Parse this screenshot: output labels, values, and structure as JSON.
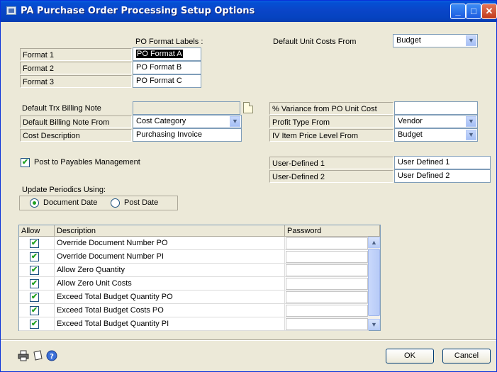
{
  "window": {
    "title": "PA Purchase Order Processing Setup Options",
    "minimize": "_",
    "maximize": "□",
    "close": "✕"
  },
  "formats": {
    "header": "PO Format Labels :",
    "rows": [
      {
        "label": "Format 1",
        "value": "PO Format A"
      },
      {
        "label": "Format 2",
        "value": "PO Format B"
      },
      {
        "label": "Format 3",
        "value": "PO Format C"
      }
    ]
  },
  "unit_costs": {
    "label": "Default Unit Costs From",
    "value": "Budget"
  },
  "billing": {
    "trx_note_label": "Default Trx Billing Note",
    "trx_note_value": "",
    "note_from_label": "Default Billing Note From",
    "note_from_value": "Cost Category",
    "cost_desc_label": "Cost Description",
    "cost_desc_value": "Purchasing Invoice"
  },
  "right_fields": {
    "variance_label": "% Variance from PO Unit Cost",
    "variance_value": "",
    "profit_type_label": "Profit Type From",
    "profit_type_value": "Vendor",
    "price_level_label": "IV Item Price Level From",
    "price_level_value": "Budget"
  },
  "post_payables": {
    "label": "Post to Payables Management",
    "checked": true
  },
  "user_defined": [
    {
      "label": "User-Defined 1",
      "value": "User Defined 1"
    },
    {
      "label": "User-Defined 2",
      "value": "User Defined 2"
    }
  ],
  "periodics": {
    "label": "Update Periodics Using:",
    "document_date": "Document Date",
    "post_date": "Post Date",
    "selected": "Document Date"
  },
  "grid": {
    "headers": {
      "allow": "Allow",
      "description": "Description",
      "password": "Password"
    },
    "rows": [
      {
        "allow": true,
        "description": "Override Document Number PO",
        "password": ""
      },
      {
        "allow": true,
        "description": "Override Document Number PI",
        "password": ""
      },
      {
        "allow": true,
        "description": "Allow Zero Quantity",
        "password": ""
      },
      {
        "allow": true,
        "description": "Allow Zero Unit Costs",
        "password": ""
      },
      {
        "allow": true,
        "description": "Exceed Total Budget Quantity PO",
        "password": ""
      },
      {
        "allow": true,
        "description": "Exceed Total Budget Costs PO",
        "password": ""
      },
      {
        "allow": true,
        "description": "Exceed Total Budget Quantity PI",
        "password": ""
      }
    ]
  },
  "buttons": {
    "ok": "OK",
    "cancel": "Cancel"
  },
  "icons": {
    "printer": "printer-icon",
    "note": "note-icon",
    "help": "help-icon"
  },
  "colors": {
    "titlebar": "#0a45c8",
    "check": "#21a121",
    "window_bg": "#ece9d8"
  }
}
